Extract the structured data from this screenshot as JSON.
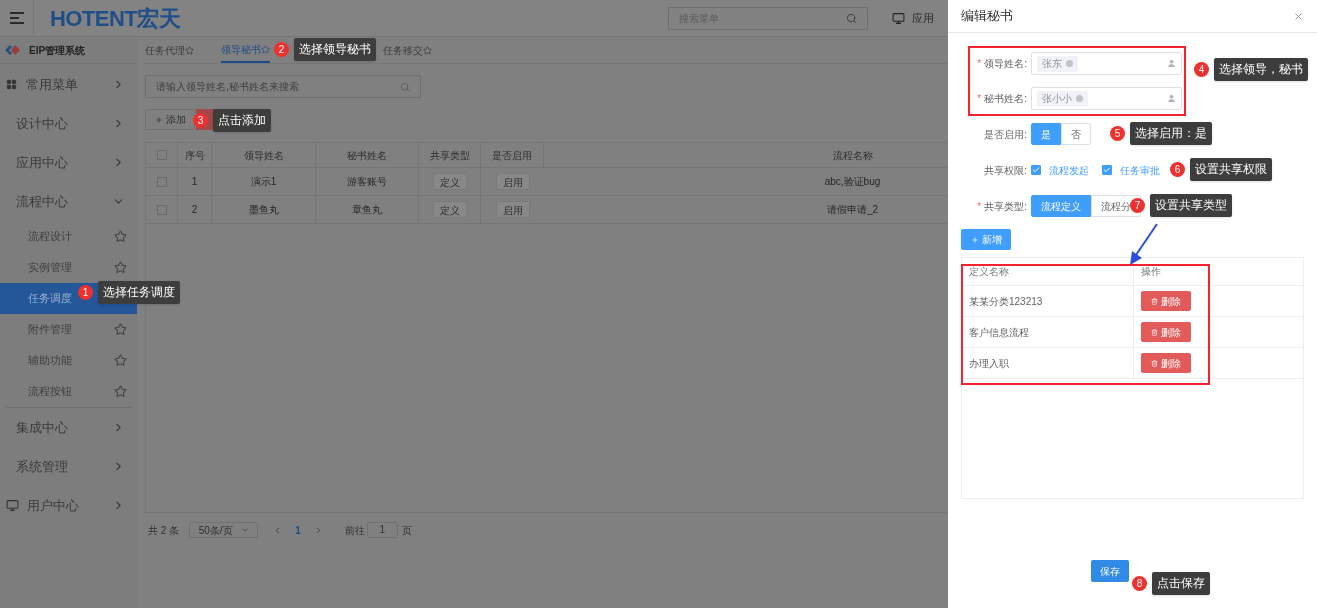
{
  "header": {
    "logo": "HOTENT宏天",
    "search_placeholder": "搜索菜单",
    "app_link": "应用"
  },
  "sidebar": {
    "system_title": "EIP管理系统",
    "items": [
      {
        "label": "常用菜单",
        "expanded": false
      },
      {
        "label": "设计中心",
        "expanded": false
      },
      {
        "label": "应用中心",
        "expanded": false
      },
      {
        "label": "流程中心",
        "expanded": true,
        "children": [
          {
            "label": "流程设计",
            "selected": false
          },
          {
            "label": "实例管理",
            "selected": false
          },
          {
            "label": "任务调度",
            "selected": true
          },
          {
            "label": "附件管理",
            "selected": false
          },
          {
            "label": "辅助功能",
            "selected": false
          },
          {
            "label": "流程按钮",
            "selected": false
          }
        ]
      },
      {
        "label": "集成中心",
        "expanded": false
      },
      {
        "label": "系统管理",
        "expanded": false
      },
      {
        "label": "用户中心",
        "expanded": false
      }
    ]
  },
  "tabs": [
    {
      "label": "任务代理",
      "selected": false
    },
    {
      "label": "领导秘书",
      "selected": true
    },
    {
      "label": "任务移交",
      "selected": false
    }
  ],
  "search": {
    "placeholder": "请输入领导姓名,秘书姓名来搜索"
  },
  "add_button": "添加",
  "table": {
    "header_checked": false,
    "columns": [
      {
        "label": "序号",
        "kind": "text"
      },
      {
        "label": "领导姓名",
        "kind": "text"
      },
      {
        "label": "秘书姓名",
        "kind": "text"
      },
      {
        "label": "共享类型",
        "kind": "tag"
      },
      {
        "label": "是否启用",
        "kind": "tag"
      },
      {
        "label": "流程名称",
        "kind": "text"
      }
    ],
    "rows": [
      {
        "checked": false,
        "cells": [
          "1",
          "演示1",
          "游客账号",
          "定义",
          "启用",
          "abc,验证bug"
        ]
      },
      {
        "checked": false,
        "cells": [
          "2",
          "墨鱼丸",
          "章鱼丸",
          "定义",
          "启用",
          "请假申请_2"
        ]
      }
    ]
  },
  "pagination": {
    "total": "共 2 条",
    "page_size": "50条/页",
    "current": "1",
    "goto_label": "前往",
    "goto_value": "1",
    "page_suffix": "页"
  },
  "drawer": {
    "title": "编辑秘书",
    "fields": [
      {
        "kind": "user_select",
        "label": "领导姓名:",
        "required_mark": "*",
        "tag": "张东"
      },
      {
        "kind": "user_select",
        "label": "秘书姓名:",
        "required_mark": "*",
        "tag": "张小小"
      },
      {
        "kind": "toggle",
        "label": "是否启用:",
        "options": [
          {
            "label": "是",
            "selected": true
          },
          {
            "label": "否",
            "selected": false
          }
        ]
      },
      {
        "kind": "checkboxes",
        "label": "共享权限:",
        "options": [
          {
            "label": "流程发起",
            "checked": true
          },
          {
            "label": "任务审批",
            "checked": true
          }
        ]
      },
      {
        "kind": "toggle",
        "label": "共享类型:",
        "required_mark": "*",
        "options": [
          {
            "label": "流程定义",
            "selected": true
          },
          {
            "label": "流程分",
            "selected": false
          }
        ]
      }
    ],
    "add_button": "新增",
    "table": {
      "columns": [
        "定义名称",
        "操作"
      ],
      "rows": [
        {
          "name": "某某分类123213",
          "action": "删除"
        },
        {
          "name": "客户信息流程",
          "action": "删除"
        },
        {
          "name": "办理入职",
          "action": "删除"
        }
      ]
    },
    "save_button": "保存"
  },
  "annotations": [
    {
      "number": "1",
      "text": "选择任务调度"
    },
    {
      "number": "2",
      "text": "选择领导秘书"
    },
    {
      "number": "3",
      "text": "点击添加"
    },
    {
      "number": "4",
      "text": "选择领导，秘书"
    },
    {
      "number": "5",
      "text": "选择启用：是"
    },
    {
      "number": "6",
      "text": "设置共享权限"
    },
    {
      "number": "7",
      "text": "设置共享类型"
    },
    {
      "number": "8",
      "text": "点击保存"
    }
  ]
}
